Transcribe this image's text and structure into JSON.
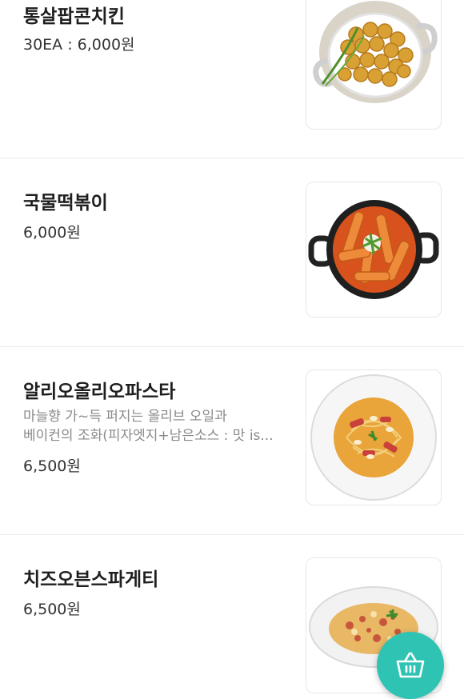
{
  "menu_items": [
    {
      "name": "통살팝콘치킨",
      "price": "30EA : 6,000원",
      "image_icon": "popcorn-chicken-photo"
    },
    {
      "name": "국물떡볶이",
      "price": "6,000원",
      "image_icon": "tteokbokki-photo"
    },
    {
      "name": "알리오올리오파스타",
      "description_line1": "마늘향 가~득 퍼지는 올리브 오일과",
      "description_line2": "베이컨의 조화(피자엣지+남은소스 : 맛 is...",
      "price": "6,500원",
      "image_icon": "aglio-olio-pasta-photo"
    },
    {
      "name": "치즈오븐스파게티",
      "price": "6,500원",
      "image_icon": "cheese-oven-spaghetti-photo"
    }
  ],
  "cart_button": {
    "icon": "shopping-basket-icon"
  },
  "colors": {
    "accent": "#2fc3b4",
    "divider": "#ececec",
    "text_primary": "#1e1e1e",
    "text_secondary": "#8a8a8a"
  }
}
